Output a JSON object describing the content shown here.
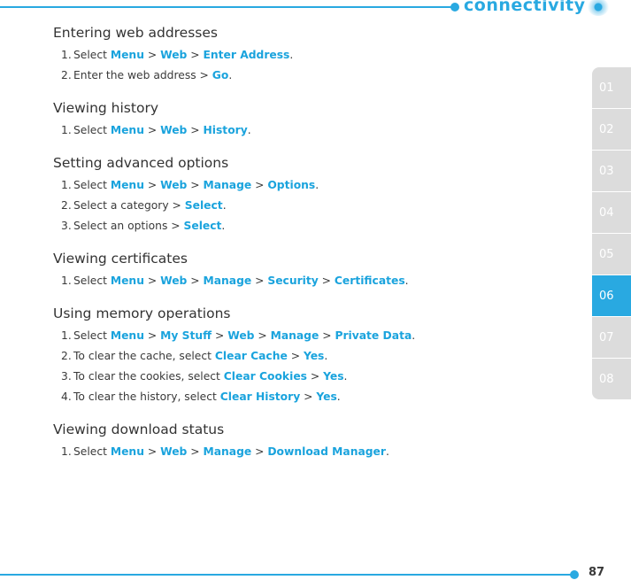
{
  "header": {
    "title": "connectivity"
  },
  "side_tabs": [
    {
      "label": "01",
      "active": false
    },
    {
      "label": "02",
      "active": false
    },
    {
      "label": "03",
      "active": false
    },
    {
      "label": "04",
      "active": false
    },
    {
      "label": "05",
      "active": false
    },
    {
      "label": "06",
      "active": true
    },
    {
      "label": "07",
      "active": false
    },
    {
      "label": "08",
      "active": false
    }
  ],
  "accent_color": "#29a9e1",
  "sections": [
    {
      "title": "Entering web addresses",
      "steps": [
        {
          "num": "1.",
          "parts": [
            {
              "t": "Select "
            },
            {
              "t": "Menu",
              "h": true
            },
            {
              "t": " > "
            },
            {
              "t": "Web",
              "h": true
            },
            {
              "t": " > "
            },
            {
              "t": "Enter Address",
              "h": true
            },
            {
              "t": "."
            }
          ]
        },
        {
          "num": "2.",
          "parts": [
            {
              "t": "Enter the web address > "
            },
            {
              "t": "Go",
              "h": true
            },
            {
              "t": "."
            }
          ]
        }
      ]
    },
    {
      "title": "Viewing history",
      "steps": [
        {
          "num": "1.",
          "parts": [
            {
              "t": "Select "
            },
            {
              "t": "Menu",
              "h": true
            },
            {
              "t": " > "
            },
            {
              "t": "Web",
              "h": true
            },
            {
              "t": " > "
            },
            {
              "t": "History",
              "h": true
            },
            {
              "t": "."
            }
          ]
        }
      ]
    },
    {
      "title": "Setting advanced options",
      "steps": [
        {
          "num": "1.",
          "parts": [
            {
              "t": "Select "
            },
            {
              "t": "Menu",
              "h": true
            },
            {
              "t": " > "
            },
            {
              "t": "Web",
              "h": true
            },
            {
              "t": " > "
            },
            {
              "t": "Manage",
              "h": true
            },
            {
              "t": " > "
            },
            {
              "t": "Options",
              "h": true
            },
            {
              "t": "."
            }
          ]
        },
        {
          "num": "2.",
          "parts": [
            {
              "t": "Select a category > "
            },
            {
              "t": "Select",
              "h": true
            },
            {
              "t": "."
            }
          ]
        },
        {
          "num": "3.",
          "parts": [
            {
              "t": "Select an options > "
            },
            {
              "t": "Select",
              "h": true
            },
            {
              "t": "."
            }
          ]
        }
      ]
    },
    {
      "title": "Viewing certificates",
      "steps": [
        {
          "num": "1.",
          "parts": [
            {
              "t": "Select "
            },
            {
              "t": "Menu",
              "h": true
            },
            {
              "t": " > "
            },
            {
              "t": "Web",
              "h": true
            },
            {
              "t": " > "
            },
            {
              "t": "Manage",
              "h": true
            },
            {
              "t": " > "
            },
            {
              "t": "Security",
              "h": true
            },
            {
              "t": " > "
            },
            {
              "t": "Certificates",
              "h": true
            },
            {
              "t": "."
            }
          ]
        }
      ]
    },
    {
      "title": "Using memory operations",
      "steps": [
        {
          "num": "1.",
          "parts": [
            {
              "t": "Select "
            },
            {
              "t": "Menu",
              "h": true
            },
            {
              "t": " > "
            },
            {
              "t": "My Stuff",
              "h": true
            },
            {
              "t": " > "
            },
            {
              "t": "Web",
              "h": true
            },
            {
              "t": " > "
            },
            {
              "t": "Manage",
              "h": true
            },
            {
              "t": " > "
            },
            {
              "t": "Private Data",
              "h": true
            },
            {
              "t": "."
            }
          ]
        },
        {
          "num": "2.",
          "parts": [
            {
              "t": "To clear the cache, select "
            },
            {
              "t": "Clear Cache",
              "h": true
            },
            {
              "t": " > "
            },
            {
              "t": "Yes",
              "h": true
            },
            {
              "t": "."
            }
          ]
        },
        {
          "num": "3.",
          "parts": [
            {
              "t": "To clear the cookies, select "
            },
            {
              "t": "Clear Cookies",
              "h": true
            },
            {
              "t": " > "
            },
            {
              "t": "Yes",
              "h": true
            },
            {
              "t": "."
            }
          ]
        },
        {
          "num": "4.",
          "parts": [
            {
              "t": "To clear the history, select "
            },
            {
              "t": "Clear History",
              "h": true
            },
            {
              "t": " > "
            },
            {
              "t": "Yes",
              "h": true
            },
            {
              "t": "."
            }
          ]
        }
      ]
    },
    {
      "title": "Viewing download status",
      "steps": [
        {
          "num": "1.",
          "parts": [
            {
              "t": "Select "
            },
            {
              "t": "Menu",
              "h": true
            },
            {
              "t": " > "
            },
            {
              "t": "Web",
              "h": true
            },
            {
              "t": " > "
            },
            {
              "t": "Manage",
              "h": true
            },
            {
              "t": " > "
            },
            {
              "t": "Download Manager",
              "h": true
            },
            {
              "t": "."
            }
          ]
        }
      ]
    }
  ],
  "footer": {
    "page_number": "87"
  }
}
